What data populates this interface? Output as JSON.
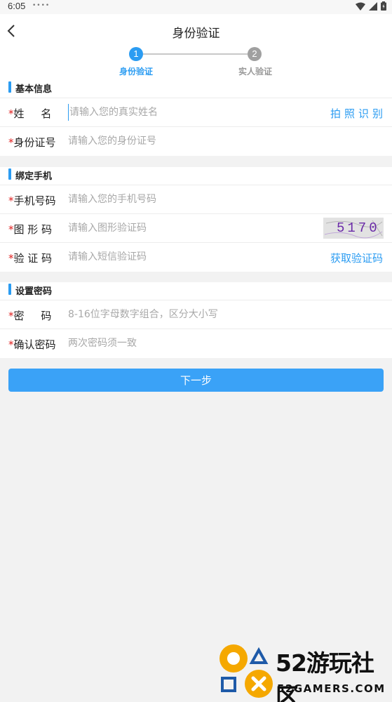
{
  "status_bar": {
    "time": "6:05",
    "dots": "••••"
  },
  "header": {
    "title": "身份验证"
  },
  "steps": [
    {
      "number": "1",
      "label": "身份验证",
      "state": "active"
    },
    {
      "number": "2",
      "label": "实人验证",
      "state": "inactive"
    }
  ],
  "colors": {
    "accent": "#2b9cf2",
    "button": "#3aa2f7",
    "required": "#e02020",
    "inactive": "#a0a0a0"
  },
  "sections": {
    "basic": {
      "title": "基本信息",
      "name": {
        "required_mark": "*",
        "label": "姓     名",
        "placeholder": "请输入您的真实姓名",
        "action": "拍照识别"
      },
      "id_card": {
        "required_mark": "*",
        "label": "身份证号",
        "placeholder": "请输入您的身份证号"
      }
    },
    "phone": {
      "title": "绑定手机",
      "mobile": {
        "required_mark": "*",
        "label": "手机号码",
        "placeholder": "请输入您的手机号码"
      },
      "captcha": {
        "required_mark": "*",
        "label": "图 形 码",
        "placeholder": "请输入图形验证码",
        "image_text": "5170"
      },
      "sms": {
        "required_mark": "*",
        "label": "验 证 码",
        "placeholder": "请输入短信验证码",
        "action": "获取验证码"
      }
    },
    "password": {
      "title": "设置密码",
      "pwd": {
        "required_mark": "*",
        "label": "密     码",
        "placeholder": "8-16位字母数字组合，区分大小写"
      },
      "confirm": {
        "required_mark": "*",
        "label": "确认密码",
        "placeholder": "两次密码须一致"
      }
    }
  },
  "next_button": {
    "label": "下一步"
  },
  "watermark": {
    "title": "52游玩社区",
    "subtitle": "52GAMERS.COM"
  }
}
